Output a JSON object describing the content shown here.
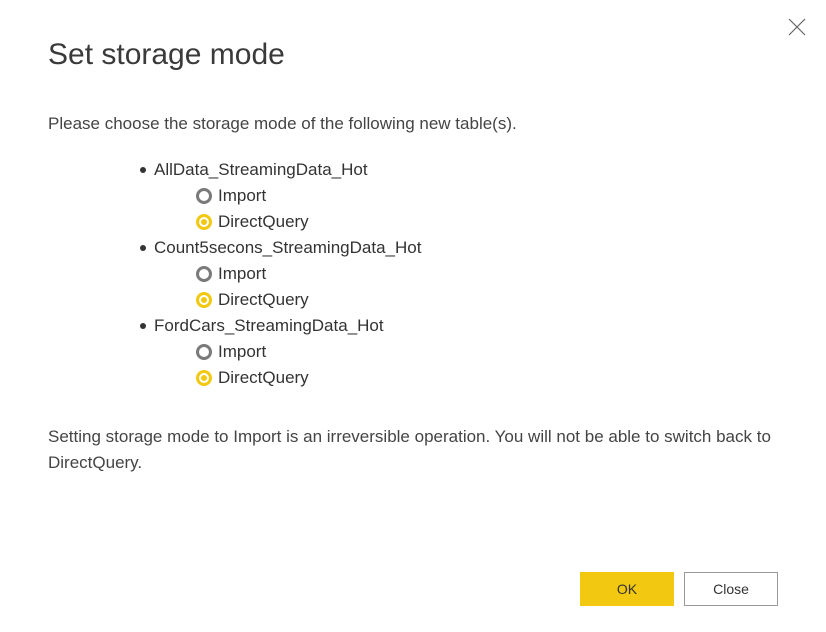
{
  "title": "Set storage mode",
  "instruction": "Please choose the storage mode of the following new table(s).",
  "tables": [
    {
      "name": "AllData_StreamingData_Hot",
      "options": [
        {
          "label": "Import",
          "selected": false
        },
        {
          "label": "DirectQuery",
          "selected": true
        }
      ]
    },
    {
      "name": "Count5secons_StreamingData_Hot",
      "options": [
        {
          "label": "Import",
          "selected": false
        },
        {
          "label": "DirectQuery",
          "selected": true
        }
      ]
    },
    {
      "name": "FordCars_StreamingData_Hot",
      "options": [
        {
          "label": "Import",
          "selected": false
        },
        {
          "label": "DirectQuery",
          "selected": true
        }
      ]
    }
  ],
  "warning": "Setting storage mode to Import is an irreversible operation. You will not be able to switch back to DirectQuery.",
  "buttons": {
    "ok": "OK",
    "close": "Close"
  }
}
